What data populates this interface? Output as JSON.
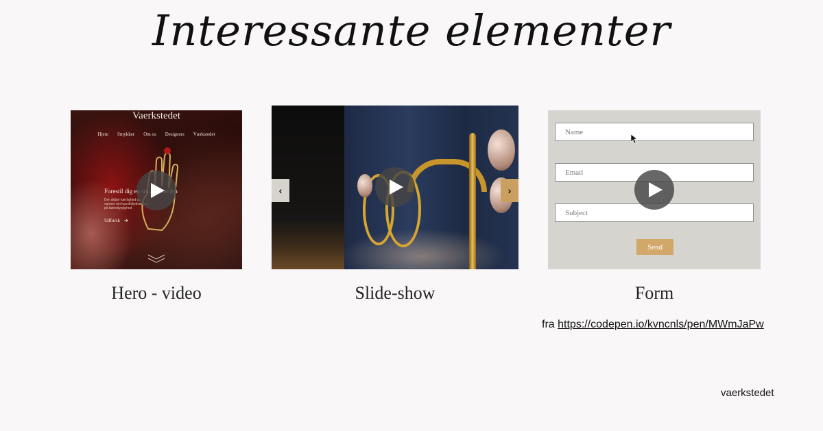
{
  "title": "Interessante elementer",
  "cards": {
    "hero": {
      "label": "Hero - video",
      "brand": "Vaerkstedet",
      "nav": [
        "Hjem",
        "Smykker",
        "Om os",
        "Designers",
        "Værkstedet"
      ],
      "headline": "Forestil dig en smykkeverden",
      "subtext": "Der skiber kærlighed og varmer om kunsthåndværket på bæredygtighed",
      "cta": "Udforsk",
      "cta_arrow": "➜"
    },
    "slideshow": {
      "label": "Slide-show",
      "prev": "‹",
      "next": "›"
    },
    "form": {
      "label": "Form",
      "name_placeholder": "Name",
      "email_placeholder": "Email",
      "subject_placeholder": "Subject",
      "send": "Send"
    }
  },
  "source": {
    "prefix": "fra",
    "url": "https://codepen.io/kvncnls/pen/MWmJaPw"
  },
  "footer": "vaerkstedet",
  "colors": {
    "background": "#f9f7f7",
    "send_button": "#d1a86a",
    "play_overlay": "#464646"
  },
  "icons": {
    "play": "play-icon",
    "prev": "chevron-left-icon",
    "next": "chevron-right-icon",
    "scroll": "chevron-down-icon"
  }
}
